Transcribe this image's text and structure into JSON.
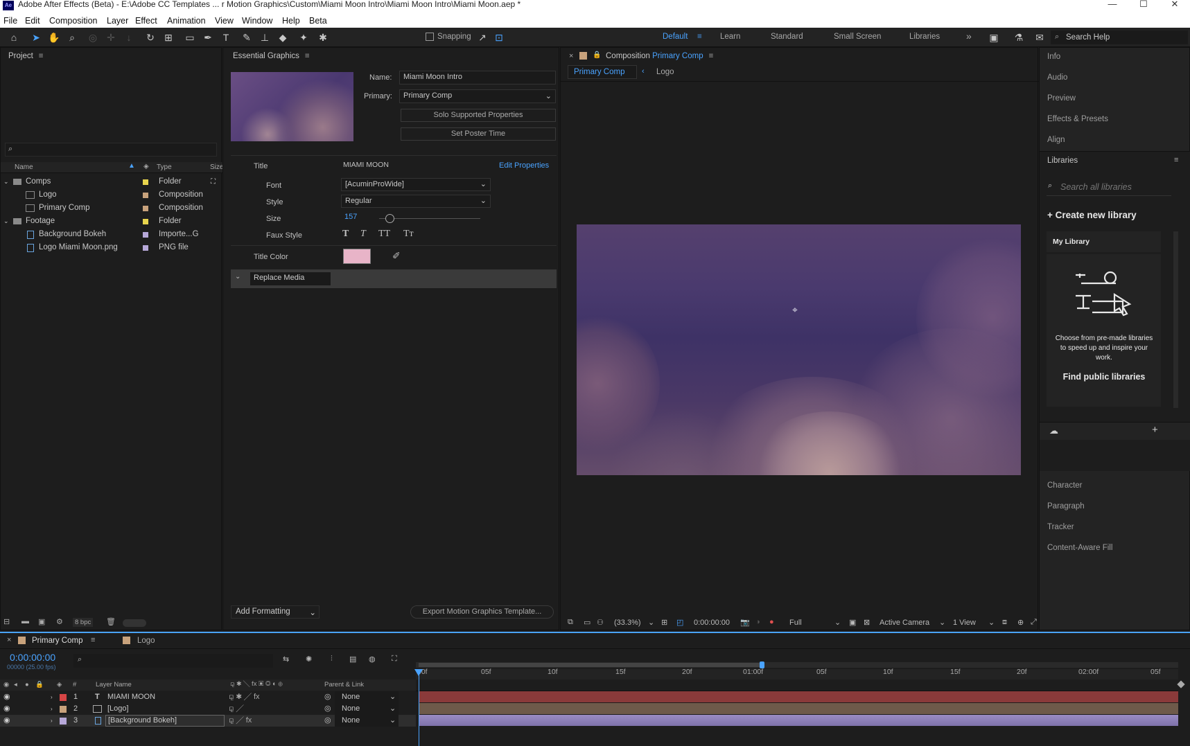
{
  "window": {
    "app_icon": "Ae",
    "title": "Adobe After Effects (Beta) - E:\\Adobe CC Templates ... r Motion Graphics\\Custom\\Miami Moon Intro\\Miami Moon Intro\\Miami Moon.aep *",
    "minimize": "—",
    "maximize": "☐",
    "close": "✕"
  },
  "menu": [
    "File",
    "Edit",
    "Composition",
    "Layer",
    "Effect",
    "Animation",
    "View",
    "Window",
    "Help",
    "Beta"
  ],
  "toolbar": {
    "snapping_label": "Snapping",
    "workspaces": [
      "Default",
      "Learn",
      "Standard",
      "Small Screen",
      "Libraries"
    ],
    "active_workspace": "Default",
    "more": "»",
    "search_placeholder": "Search Help"
  },
  "project": {
    "title": "Project",
    "search_icon": "⌕",
    "columns": {
      "name": "Name",
      "type": "Type",
      "size": "Size"
    },
    "items": [
      {
        "name": "Comps",
        "type": "Folder",
        "color": "#e8d44d",
        "icon": "folder"
      },
      {
        "name": "Logo",
        "type": "Composition",
        "color": "#c8a27c",
        "icon": "comp"
      },
      {
        "name": "Primary Comp",
        "type": "Composition",
        "color": "#c8a27c",
        "icon": "comp"
      },
      {
        "name": "Footage",
        "type": "Folder",
        "color": "#e8d44d",
        "icon": "folder"
      },
      {
        "name": "Background Bokeh",
        "type": "Importe...G",
        "color": "#b6a8d8",
        "icon": "file"
      },
      {
        "name": "Logo Miami Moon.png",
        "type": "PNG file",
        "color": "#b6a8d8",
        "icon": "file"
      }
    ],
    "bpc": "8 bpc"
  },
  "essential_graphics": {
    "title": "Essential Graphics",
    "name_label": "Name:",
    "name_value": "Miami Moon Intro",
    "primary_label": "Primary:",
    "primary_value": "Primary Comp",
    "solo_button": "Solo Supported Properties",
    "poster_button": "Set Poster Time",
    "title_label": "Title",
    "title_value": "MIAMI MOON",
    "edit_properties": "Edit Properties",
    "font_label": "Font",
    "font_value": "[AcuminProWide]",
    "style_label": "Style",
    "style_value": "Regular",
    "size_label": "Size",
    "size_value": "157",
    "faux_label": "Faux Style",
    "faux_buttons": [
      "T",
      "T",
      "TT",
      "Tт"
    ],
    "title_color_label": "Title Color",
    "title_color": "#e8b4c8",
    "replace_media": "Replace Media",
    "add_formatting": "Add Formatting",
    "export_button": "Export Motion Graphics Template..."
  },
  "composition": {
    "panel_label": "Composition",
    "panel_name": "Primary Comp",
    "breadcrumbs": [
      "Primary Comp",
      "Logo"
    ],
    "zoom": "(33.3%)",
    "timecode": "0:00:00:00",
    "resolution": "Full",
    "camera": "Active Camera",
    "views": "1 View"
  },
  "right_panels": {
    "top": [
      "Info",
      "Audio",
      "Preview",
      "Effects & Presets",
      "Align"
    ],
    "libraries_title": "Libraries",
    "search_placeholder": "Search all libraries",
    "create_library": "+ Create new library",
    "my_library": "My Library",
    "promo_text": "Choose from pre-made libraries to speed up and inspire your work.",
    "find_public": "Find public libraries",
    "bottom": [
      "Character",
      "Paragraph",
      "Tracker",
      "Content-Aware Fill"
    ]
  },
  "timeline": {
    "tabs": [
      "Primary Comp",
      "Logo"
    ],
    "timecode": "0:00:00:00",
    "fps": "00000 (25.00 fps)",
    "col_layer_name": "Layer Name",
    "col_parent": "Parent & Link",
    "layers": [
      {
        "num": "1",
        "name": "MIAMI MOON",
        "color": "#d64545",
        "parent": "None",
        "kind": "T"
      },
      {
        "num": "2",
        "name": "[Logo]",
        "color": "#c8a27c",
        "parent": "None",
        "kind": "comp"
      },
      {
        "num": "3",
        "name": "[Background Bokeh]",
        "color": "#b6a8d8",
        "parent": "None",
        "kind": "file"
      }
    ],
    "ruler": [
      "00f",
      "05f",
      "10f",
      "15f",
      "20f",
      "01:00f",
      "05f",
      "10f",
      "15f",
      "20f",
      "02:00f",
      "05f"
    ]
  }
}
